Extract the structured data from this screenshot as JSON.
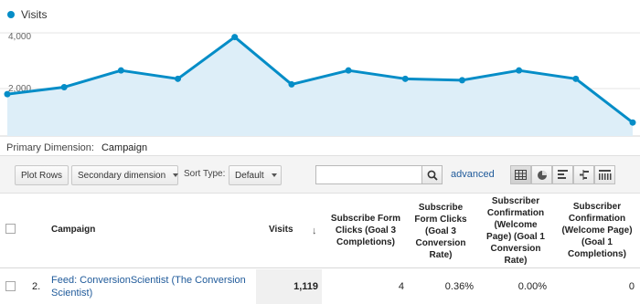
{
  "chart": {
    "legend_label": "Visits",
    "y_ticks": [
      "4,000",
      "2,000"
    ],
    "line_color": "#058dc7",
    "fill_color": "#ddeef8"
  },
  "chart_data": {
    "type": "area",
    "series": [
      {
        "values": [
          1800,
          2050,
          2650,
          2350,
          3850,
          2150,
          2650,
          2350,
          2300,
          2650,
          2350,
          780
        ]
      }
    ],
    "ylim": [
      0,
      4000
    ],
    "y_ticks": [
      2000,
      4000
    ],
    "grid": true
  },
  "primary_dimension": {
    "label": "Primary Dimension:",
    "value": "Campaign"
  },
  "toolbar": {
    "plot_rows": "Plot Rows",
    "secondary_dimension": "Secondary dimension",
    "sort_type_label": "Sort Type:",
    "sort_type_value": "Default",
    "search_value": "",
    "advanced": "advanced",
    "view_icons": [
      "table-view-icon",
      "pie-view-icon",
      "performance-view-icon",
      "comparison-view-icon",
      "pivot-view-icon"
    ]
  },
  "table": {
    "headers": {
      "campaign": "Campaign",
      "visits": "Visits",
      "sort_arrow": "↓",
      "col3": "Subscribe Form Clicks (Goal 3 Completions)",
      "col4": "Subscribe Form Clicks (Goal 3 Conversion Rate)",
      "col5": "Subscriber Confirmation (Welcome Page) (Goal 1 Conversion Rate)",
      "col6": "Subscriber Confirmation (Welcome Page) (Goal 1 Completions)"
    },
    "rows": [
      {
        "index": "2.",
        "campaign": "Feed: ConversionScientist (The Conversion Scientist)",
        "visits": "1,119",
        "goal3_completions": "4",
        "goal3_rate": "0.36%",
        "goal1_rate": "0.00%",
        "goal1_completions": "0"
      }
    ]
  }
}
